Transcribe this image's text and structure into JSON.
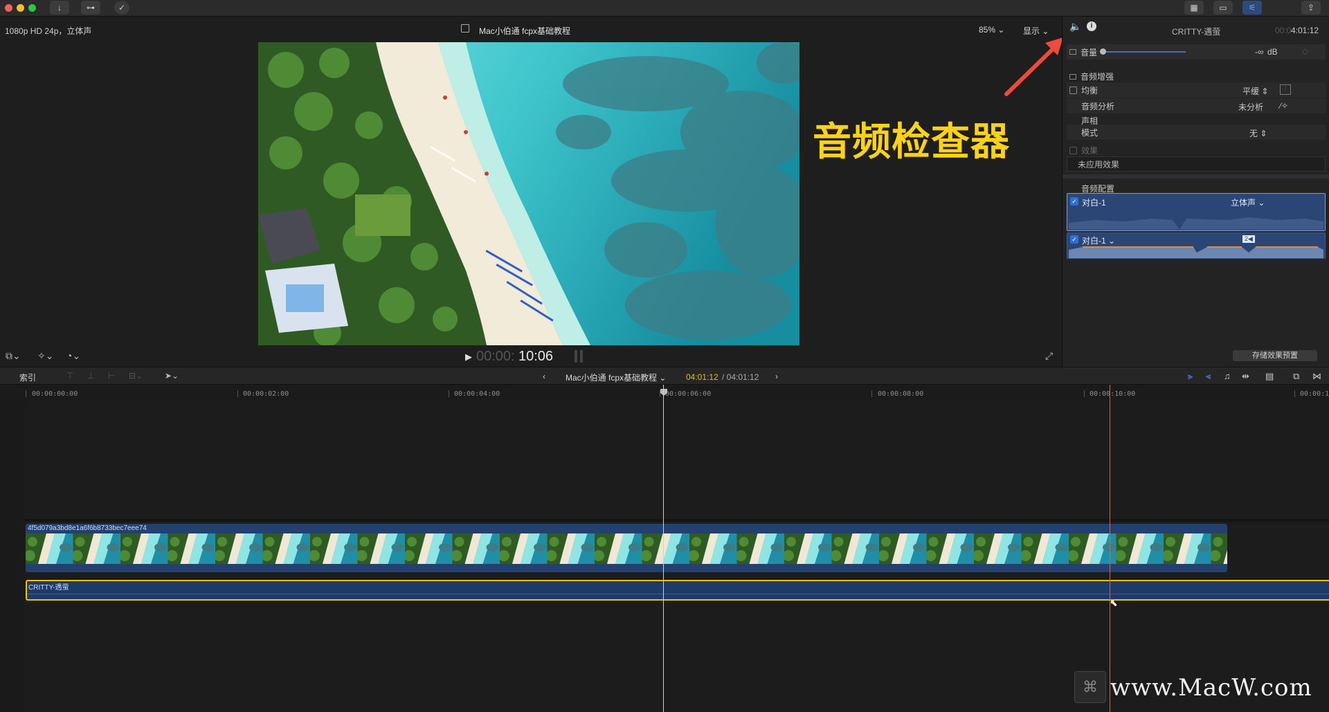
{
  "toolbar": {
    "download_icon": "↓",
    "key_icon": "⊶",
    "check_icon": "✓",
    "view_buttons": [
      "▦",
      "▭",
      "⚟"
    ],
    "share_icon": "⇪"
  },
  "viewer": {
    "format": "1080p HD 24p，立体声",
    "project_title": "Mac小伯通 fcpx基础教程",
    "zoom": "85%",
    "display_menu": "显示",
    "timecode_dim": "00:00:",
    "timecode_bright": "10:06",
    "annotation": "音频检查器"
  },
  "inspector": {
    "clip_name": "CRITTY-遇萤",
    "timecode_dim": "00:0",
    "timecode_bright": "4:01:12",
    "volume_label": "音量",
    "volume_value": "-∞",
    "volume_unit": "dB",
    "enhance_title": "音频增强",
    "eq_label": "均衡",
    "eq_value": "平缓",
    "analysis_label": "音频分析",
    "analysis_value": "未分析",
    "pan_title": "声相",
    "mode_label": "模式",
    "mode_value": "无",
    "effects_label": "效果",
    "no_effects": "未应用效果",
    "config_title": "音频配置",
    "channel1_name": "对白-1",
    "channel1_format": "立体声",
    "channel2_name": "对白-1",
    "channel2_badge": "2◀",
    "save_preset": "存储效果预置"
  },
  "timeline": {
    "index_label": "索引",
    "project_title": "Mac小伯通 fcpx基础教程",
    "position": "04:01:12",
    "duration": "/ 04:01:12",
    "ruler_labels": [
      "00:00:00:00",
      "00:00:02:00",
      "00:00:04:00",
      "00:00:06:00",
      "00:00:08:00",
      "00:00:10:00",
      "00:00:1"
    ],
    "video_clip_name": "4f5d079a3bd8e1a6f6b8733bec7eee74",
    "audio_clip_name": "CRITTY-遇萤"
  },
  "watermark": "www.MacW.com",
  "colors": {
    "accent_blue": "#5b8cff",
    "annotation_yellow": "#ffd21a",
    "arrow_red": "#f04a3c",
    "clip_blue": "#24406e",
    "audio_outline": "#e9c316",
    "playhead_orange": "#e8622a"
  }
}
